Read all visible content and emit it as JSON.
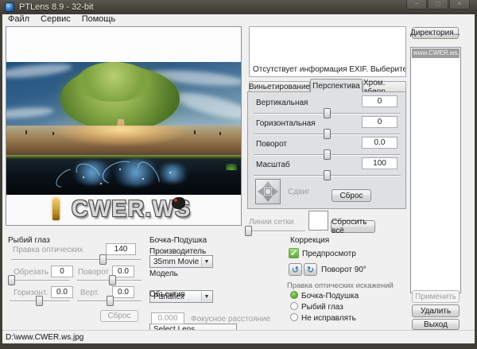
{
  "window": {
    "title": "PTLens 8.9 - 32-bit",
    "menu": {
      "file": "Файл",
      "service": "Сервис",
      "help": "Помощь"
    },
    "status": "D:\\www.CWER.ws.jpg"
  },
  "preview": {
    "watermark": "CWER.WS"
  },
  "exif": {
    "message": "Отсутствует информация EXIF. Выберите"
  },
  "right_panel": {
    "directory_button": "Директория...",
    "files": {
      "selected": "www.CWER.ws.jpg"
    },
    "apply_button": "Применить",
    "delete_button": "Удалить",
    "exit_button": "Выход"
  },
  "tabs": {
    "vignetting": "Виньетирование",
    "perspective": "Перспектива",
    "chromatic": "Хром. аберр."
  },
  "perspective": {
    "rows": [
      {
        "label": "Вертикальная",
        "value": "0"
      },
      {
        "label": "Горизонтальная",
        "value": "0"
      },
      {
        "label": "Поворот",
        "value": "0.0"
      },
      {
        "label": "Масштаб",
        "value": "100"
      }
    ],
    "shift_label": "Сдвиг",
    "reset_button": "Сброс"
  },
  "grid": {
    "label": "Линии сетки",
    "reset_all_button": "Сбросить всё"
  },
  "correction": {
    "title": "Коррекция",
    "preview_label": "Предпросмотр",
    "rotate_label": "Поворот 90°",
    "rotate_ccw_glyph": "↺",
    "rotate_cw_glyph": "↻",
    "distortion_title": "Правка оптических искажений",
    "options": [
      {
        "label": "Бочка-Подушка"
      },
      {
        "label": "Рыбий глаз"
      },
      {
        "label": "Не исправлять"
      }
    ]
  },
  "fisheye": {
    "title": "Рыбий глаз",
    "optics": {
      "label": "Правка оптических",
      "value": "140"
    },
    "crop": {
      "label": "Обрезать",
      "value": "0"
    },
    "rotate": {
      "label": "Поворот",
      "value": "0.0"
    },
    "horizontal": {
      "label": "Горизонт.",
      "value": "0.0"
    },
    "vertical": {
      "label": "Верт.",
      "value": "0.0"
    },
    "reset_button": "Сброс"
  },
  "barrel": {
    "title": "Бочка-Подушка",
    "manufacturer_label": "Производитель",
    "manufacturer_value": "35mm Movie",
    "model_label": "Модель",
    "model_value": "Panaflex",
    "lens_label": "Объектив",
    "lens_value": "Select Lens",
    "focal_value": "0.000",
    "focal_label": "Фокусное расстояние"
  },
  "colors": {
    "accent_green": "#55a52d",
    "titlebar": "#47453d",
    "selection_gray": "#9c9c9c",
    "panel_gray": "#dfe0e2"
  }
}
